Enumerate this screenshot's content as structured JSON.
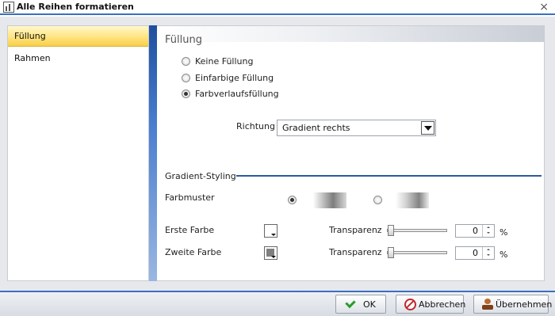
{
  "window": {
    "title": "Alle Reihen formatieren",
    "close_glyph": "×"
  },
  "sidebar": {
    "items": [
      {
        "label": "Füllung",
        "active": true
      },
      {
        "label": "Rahmen",
        "active": false
      }
    ]
  },
  "fill": {
    "section_title": "Füllung",
    "options": [
      {
        "label": "Keine Füllung",
        "checked": false
      },
      {
        "label": "Einfarbige Füllung",
        "checked": false
      },
      {
        "label": "Farbverlaufsfüllung",
        "checked": true
      }
    ],
    "direction": {
      "label": "Richtung",
      "value": "Gradient rechts"
    }
  },
  "gradient_styling": {
    "title": "Gradient-Styling",
    "pattern": {
      "label": "Farbmuster",
      "selected_index": 0
    },
    "first_color": {
      "label": "Erste Farbe",
      "color": "#ffffff",
      "transparency_label": "Transparenz",
      "transparency_value": "0",
      "unit": "%"
    },
    "second_color": {
      "label": "Zweite Farbe",
      "color": "#7f7f7f",
      "transparency_label": "Transparenz",
      "transparency_value": "0",
      "unit": "%"
    }
  },
  "footer": {
    "ok_label": "OK",
    "cancel_label": "Abbrechen",
    "apply_label": "Übernehmen"
  },
  "colors": {
    "accent": "#3a6fc0",
    "active_tab": "#ffe27a",
    "ok_check": "#2a9d2a",
    "cancel_red": "#c0262d"
  },
  "icons": {
    "app": "chart-icon",
    "ok": "checkmark-icon",
    "cancel": "no-entry-icon",
    "apply": "stamp-icon"
  }
}
